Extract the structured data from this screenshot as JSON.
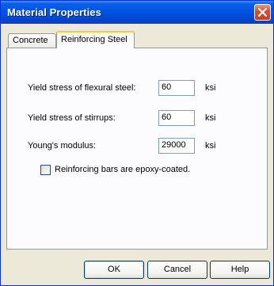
{
  "window": {
    "title": "Material Properties"
  },
  "tabs": [
    {
      "label": "Concrete"
    },
    {
      "label": "Reinforcing Steel"
    }
  ],
  "fields": [
    {
      "label": "Yield stress of flexural steel:",
      "value": "60",
      "unit": "ksi"
    },
    {
      "label": "Yield stress of stirrups:",
      "value": "60",
      "unit": "ksi"
    },
    {
      "label": "Young's modulus:",
      "value": "29000",
      "unit": "ksi"
    }
  ],
  "epoxy_checkbox": {
    "label": "Reinforcing bars are epoxy-coated.",
    "checked": false
  },
  "buttons": {
    "ok": "OK",
    "cancel": "Cancel",
    "help": "Help"
  },
  "icons": {
    "close": "close-icon"
  },
  "colors": {
    "title_bar": "#0054e3",
    "close_button": "#d6542e",
    "dialog_face": "#ece9d8",
    "active_tab_highlight": "#ffc83c"
  }
}
